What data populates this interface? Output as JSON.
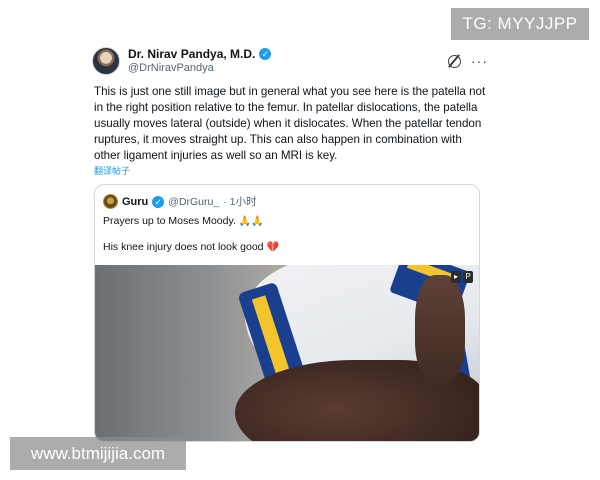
{
  "tweet": {
    "author": {
      "display_name": "Dr. Nirav Pandya, M.D.",
      "handle": "@DrNiravPandya",
      "verified_mark": "✓"
    },
    "actions": {
      "grok_icon": "grok-icon",
      "more_label": "···"
    },
    "text": "This is just one still image but in general what you see here is the patella not in the right position relative to the femur. In patellar dislocations, the patella usually moves lateral (outside) when it dislocates.  When the patellar tendon ruptures, it moves straight up.  This can also happen in combination with other ligament injuries as well so an MRI is key.",
    "translate_label": "翻译帖子"
  },
  "quote": {
    "author": {
      "display_name": "Guru",
      "handle": "@DrGuru_",
      "verified_mark": "✓",
      "time": "· 1小时"
    },
    "line1": "Prayers up to Moses Moody. ",
    "line1_emoji": "🙏🙏",
    "line2": "His knee injury does not look good ",
    "line2_emoji": "💔",
    "media_badges": [
      "▸",
      "P"
    ]
  },
  "watermarks": {
    "top_right": "TG: MYYJJPP",
    "bottom_left": "www.btmijijia.com"
  },
  "colors": {
    "accent": "#1d9bf0",
    "text": "#0f1419",
    "muted": "#536471",
    "border": "#cfd9de",
    "watermark_bg": "#8c8c8c"
  }
}
